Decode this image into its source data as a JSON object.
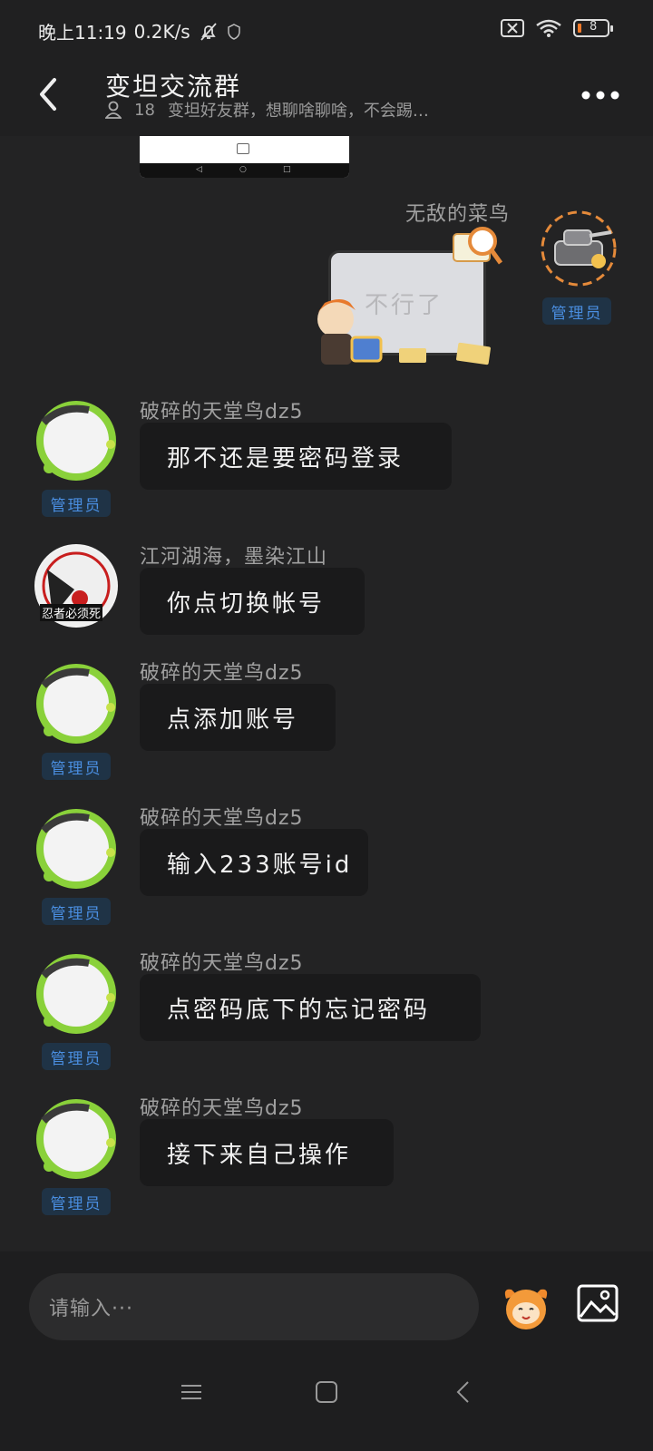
{
  "status_bar": {
    "time": "晚上11:19",
    "speed": "0.2K/s",
    "battery": "8",
    "icons": [
      "mute-bell-icon",
      "shield-icon",
      "no-sim-icon",
      "wifi-icon",
      "battery-icon"
    ]
  },
  "header": {
    "title": "变坦交流群",
    "member_count": "18",
    "description": "变坦好友群，想聊啥聊啥，不会踢…"
  },
  "colors": {
    "badge_text": "#4a8ee0",
    "bubble_bg": "#1a1a1b",
    "background": "#232324"
  },
  "messages": [
    {
      "sender": "无敌的菜鸟",
      "type": "sticker",
      "sticker_text": "不行了",
      "badge": "管理员"
    },
    {
      "sender": "破碎的天堂鸟dz5",
      "text": "那不还是要密码登录",
      "badge": "管理员"
    },
    {
      "sender": "江河湖海，墨染江山",
      "text": "你点切换帐号",
      "avatar_text": "忍者必须死"
    },
    {
      "sender": "破碎的天堂鸟dz5",
      "text": "点添加账号",
      "badge": "管理员"
    },
    {
      "sender": "破碎的天堂鸟dz5",
      "text": "输入233账号id",
      "badge": "管理员"
    },
    {
      "sender": "破碎的天堂鸟dz5",
      "text": "点密码底下的忘记密码",
      "badge": "管理员"
    },
    {
      "sender": "破碎的天堂鸟dz5",
      "text": "接下来自己操作",
      "badge": "管理员"
    }
  ],
  "input": {
    "placeholder": "请输入···"
  }
}
